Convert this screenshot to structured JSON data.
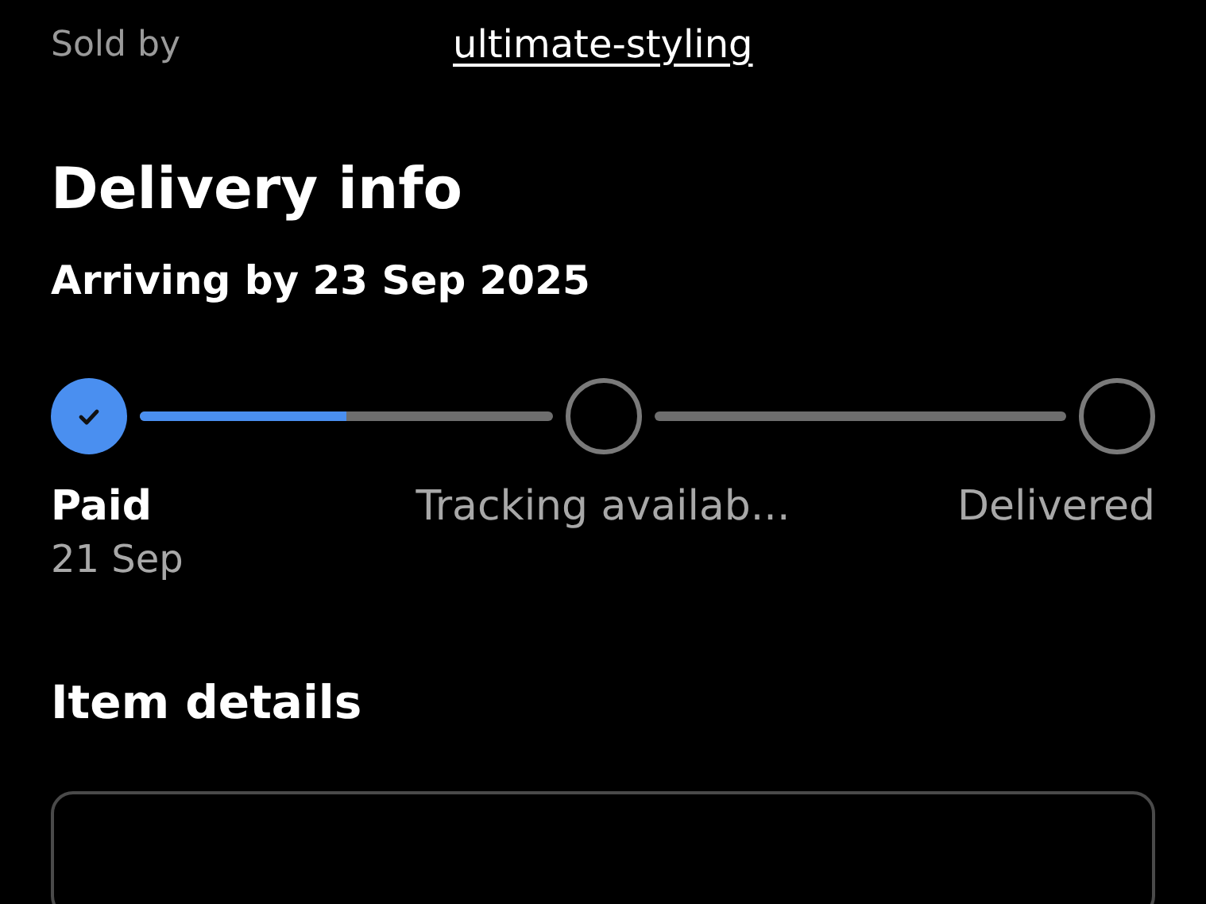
{
  "seller": {
    "label": "Sold by",
    "name": "ultimate-styling"
  },
  "delivery": {
    "title": "Delivery info",
    "arrival": "Arriving by 23 Sep 2025",
    "steps": [
      {
        "label": "Paid",
        "date": "21 Sep",
        "done": true
      },
      {
        "label": "Tracking availab...",
        "done": false
      },
      {
        "label": "Delivered",
        "done": false
      }
    ],
    "connectors": [
      {
        "level": 0.5
      },
      {
        "level": 0
      }
    ]
  },
  "item_details": {
    "title": "Item details"
  }
}
